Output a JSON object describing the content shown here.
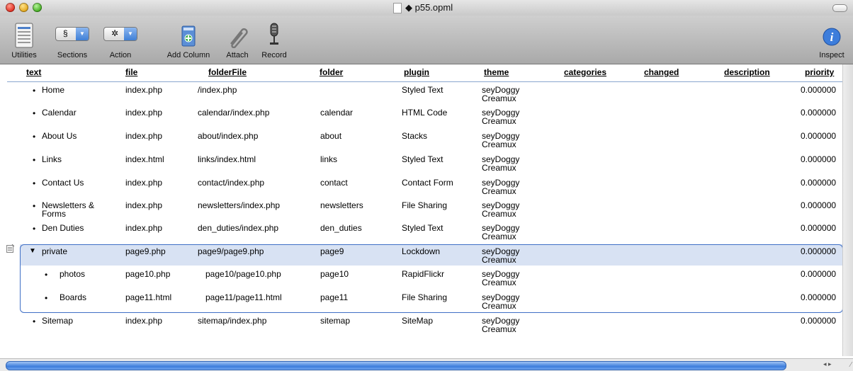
{
  "window": {
    "title": "◆ p55.opml"
  },
  "toolbar": {
    "utilities": "Utilities",
    "sections": "Sections",
    "sections_glyph": "§",
    "action": "Action",
    "action_glyph": "✲",
    "add_column": "Add Column",
    "attach": "Attach",
    "record": "Record",
    "inspect": "Inspect"
  },
  "columns": [
    "text",
    "file",
    "folderFile",
    "folder",
    "plugin",
    "theme",
    "categories",
    "changed",
    "description",
    "priority"
  ],
  "rows": [
    {
      "text": "Home",
      "file": "index.php",
      "folderFile": "/index.php",
      "folder": "",
      "plugin": "Styled Text",
      "theme1": "seyDoggy",
      "theme2": "Creamux",
      "priority": "0.000000"
    },
    {
      "text": "Calendar",
      "file": "index.php",
      "folderFile": "calendar/index.php",
      "folder": "calendar",
      "plugin": "HTML Code",
      "theme1": "seyDoggy",
      "theme2": "Creamux",
      "priority": "0.000000"
    },
    {
      "text": "About Us",
      "file": "index.php",
      "folderFile": "about/index.php",
      "folder": "about",
      "plugin": "Stacks",
      "theme1": "seyDoggy",
      "theme2": "Creamux",
      "priority": "0.000000"
    },
    {
      "text": "Links",
      "file": "index.html",
      "folderFile": "links/index.html",
      "folder": "links",
      "plugin": "Styled Text",
      "theme1": "seyDoggy",
      "theme2": "Creamux",
      "priority": "0.000000"
    },
    {
      "text": "Contact Us",
      "file": "index.php",
      "folderFile": "contact/index.php",
      "folder": "contact",
      "plugin": "Contact Form",
      "theme1": "seyDoggy",
      "theme2": "Creamux",
      "priority": "0.000000"
    },
    {
      "text": "Newsletters & Forms",
      "file": "index.php",
      "folderFile": "newsletters/index.php",
      "folder": "newsletters",
      "plugin": "File Sharing",
      "theme1": "seyDoggy",
      "theme2": "Creamux",
      "priority": "0.000000"
    },
    {
      "text": "Den Duties",
      "file": "index.php",
      "folderFile": "den_duties/index.php",
      "folder": "den_duties",
      "plugin": "Styled Text",
      "theme1": "seyDoggy",
      "theme2": "Creamux",
      "priority": "0.000000"
    },
    {
      "text": "private",
      "file": "page9.php",
      "folderFile": "page9/page9.php",
      "folder": "page9",
      "plugin": "Lockdown",
      "theme1": "seyDoggy",
      "theme2": "Creamux",
      "priority": "0.000000"
    },
    {
      "text": "photos",
      "file": "page10.php",
      "folderFile": "page10/page10.php",
      "folder": "page10",
      "plugin": "RapidFlickr",
      "theme1": "seyDoggy",
      "theme2": "Creamux",
      "priority": "0.000000"
    },
    {
      "text": "Boards",
      "file": "page11.html",
      "folderFile": "page11/page11.html",
      "folder": "page11",
      "plugin": "File Sharing",
      "theme1": "seyDoggy",
      "theme2": "Creamux",
      "priority": "0.000000"
    },
    {
      "text": "Sitemap",
      "file": "index.php",
      "folderFile": "sitemap/index.php",
      "folder": "sitemap",
      "plugin": "SiteMap",
      "theme1": "seyDoggy",
      "theme2": "Creamux",
      "priority": "0.000000"
    }
  ],
  "icons": {
    "disclosure": "▼",
    "bullet": "•"
  }
}
